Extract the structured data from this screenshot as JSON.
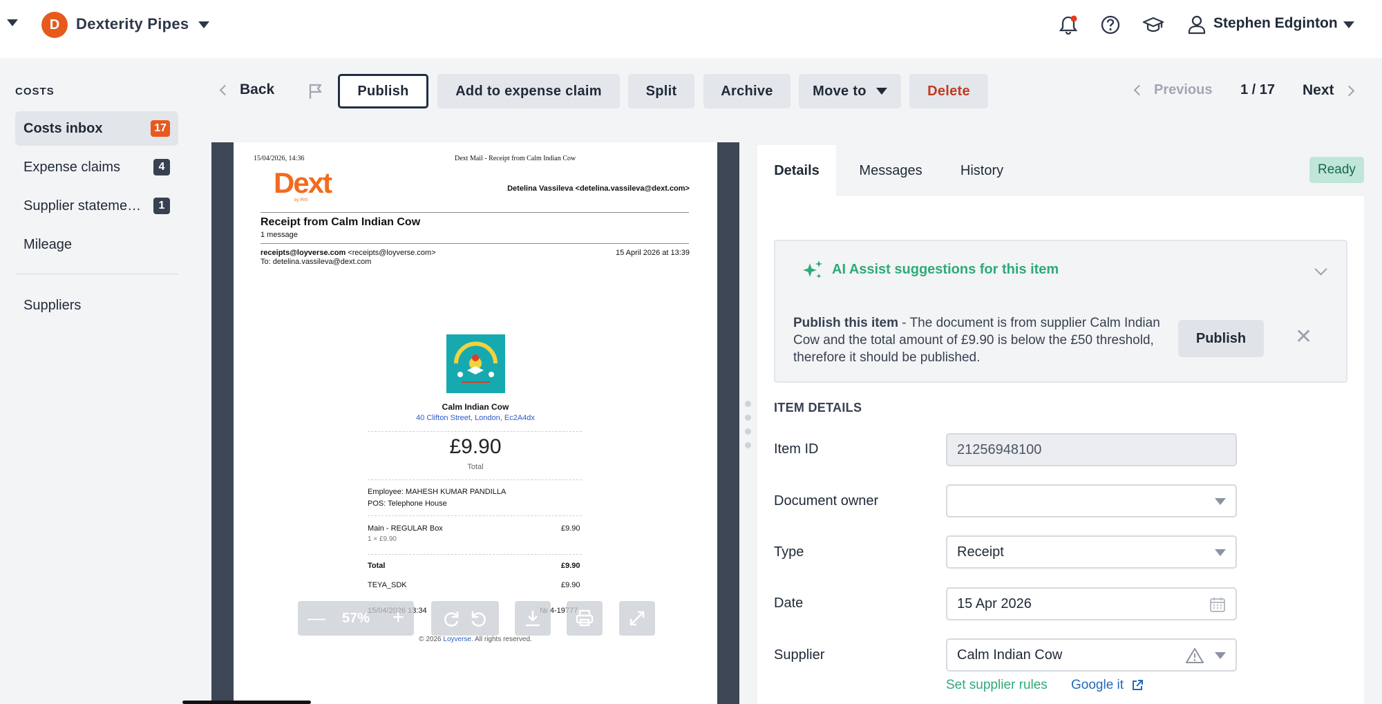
{
  "topbar": {
    "org_initial": "D",
    "org_name": "Dexterity Pipes",
    "user_name": "Stephen Edginton"
  },
  "sidebar": {
    "section": "COSTS",
    "items": [
      {
        "label": "Costs inbox",
        "badge": "17"
      },
      {
        "label": "Expense claims",
        "badge": "4"
      },
      {
        "label": "Supplier stateme…",
        "badge": "1"
      },
      {
        "label": "Mileage"
      }
    ],
    "suppliers": "Suppliers"
  },
  "toolbar": {
    "back": "Back",
    "publish": "Publish",
    "add_expense": "Add to expense claim",
    "split": "Split",
    "archive": "Archive",
    "move_to": "Move to",
    "delete": "Delete",
    "previous": "Previous",
    "page_count": "1 / 17",
    "next": "Next"
  },
  "document": {
    "print_date": "15/04/2026, 14:36",
    "print_title": "Dext Mail - Receipt from Calm Indian Cow",
    "logo_text": "Dext",
    "logo_sub": "by IRIS",
    "from_user": "Detelina Vassileva <detelina.vassileva@dext.com>",
    "subject": "Receipt from Calm Indian Cow",
    "message_count": "1 message",
    "sender_bold": "receipts@loyverse.com",
    "sender_rest": "<receipts@loyverse.com>",
    "sent_date": "15 April 2026 at 13:39",
    "to": "To: detelina.vassileva@dext.com",
    "merchant": "Calm Indian Cow",
    "address": "40 Clifton Street, London, Ec2A4dx",
    "total_amount": "£9.90",
    "total_label": "Total",
    "employee": "Employee: MAHESH KUMAR PANDILLA",
    "pos": "POS: Telephone House",
    "line_item": "Main - REGULAR Box",
    "line_item_price": "£9.90",
    "line_item_qty": "1 × £9.90",
    "total_row_label": "Total",
    "total_row_value": "£9.90",
    "payment_label": "TEYA_SDK",
    "payment_value": "£9.90",
    "receipt_datetime": "15/04/2026 13:34",
    "receipt_no": "№ 4-19777",
    "footer_pre": "© 2026 ",
    "footer_link": "Loyverse",
    "footer_post": ". All rights reserved.",
    "zoom": "57%",
    "accent_orange": "#f26b1d",
    "viewer_bg": "#3d4654"
  },
  "panel": {
    "tabs": [
      "Details",
      "Messages",
      "History"
    ],
    "status": "Ready",
    "ai": {
      "title": "AI Assist suggestions for this item",
      "text_bold": "Publish this item",
      "text_rest": " - The document is from supplier Calm Indian Cow and the total amount of £9.90 is below the £50 threshold, therefore it should be published.",
      "publish": "Publish"
    },
    "section_title": "ITEM DETAILS",
    "fields": {
      "item_id_label": "Item ID",
      "item_id": "21256948100",
      "owner_label": "Document owner",
      "owner": "",
      "type_label": "Type",
      "type": "Receipt",
      "date_label": "Date",
      "date": "15 Apr 2026",
      "supplier_label": "Supplier",
      "supplier": "Calm Indian Cow"
    },
    "set_supplier_rules": "Set supplier rules",
    "google_it": "Google it"
  },
  "colors": {
    "brand_orange": "#e65a1e",
    "ai_green": "#2eaa78",
    "danger": "#c23a22",
    "ready_bg": "#bfe6d8",
    "link_blue": "#2269b8"
  }
}
